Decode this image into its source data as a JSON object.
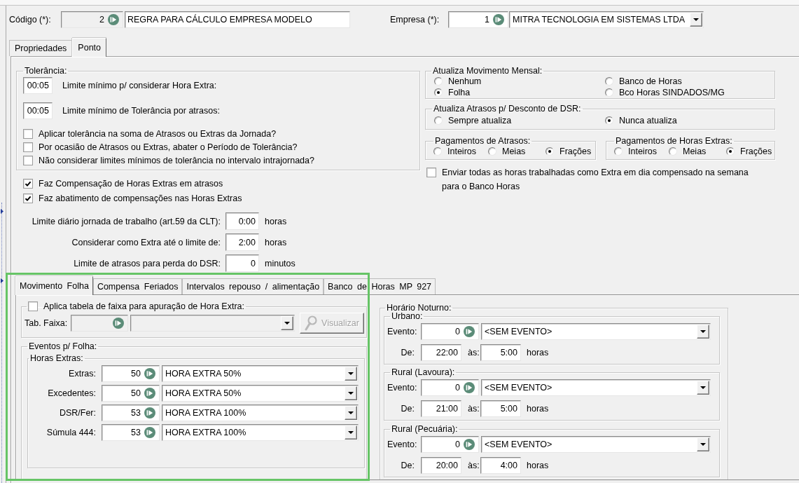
{
  "header": {
    "codigo": {
      "label": "Código (*):",
      "code": "2",
      "readonly": true,
      "kind": "text",
      "name": "REGRA PARA CÁLCULO EMPRESA MODELO"
    },
    "empresa": {
      "label": "Empresa (*):",
      "code": "1",
      "readonly": false,
      "kind": "dropdown",
      "name": "MITRA TECNOLOGIA EM SISTEMAS LTDA"
    }
  },
  "tabs": [
    {
      "label": "Propriedades",
      "selected": false
    },
    {
      "label": "Ponto",
      "selected": true
    }
  ],
  "tolerancia": {
    "title": "Tolerância:",
    "fields": [
      {
        "value": "00:05",
        "label": "Limite mínimo p/ considerar Hora Extra:"
      },
      {
        "value": "00:05",
        "label": "Limite mínimo de Tolerância por atrasos:"
      }
    ],
    "checkboxes": [
      {
        "label": "Aplicar tolerância na soma de Atrasos ou Extras da Jornada?",
        "checked": false
      },
      {
        "label": "Por ocasião de Atrasos ou Extras, abater o Período de Tolerância?",
        "checked": false
      },
      {
        "label": "Não considerar limites mínimos de tolerância no intervalo intrajornada?",
        "checked": false
      }
    ]
  },
  "compensacao": [
    {
      "label": "Faz Compensação de Horas Extras em atrasos",
      "checked": true
    },
    {
      "label": "Faz abatimento de compensações nas Horas Extras",
      "checked": true
    }
  ],
  "limites": [
    {
      "label": "Limite diário jornada de trabalho (art.59 da CLT):",
      "value": "0:00",
      "unit": "horas"
    },
    {
      "label": "Considerar como Extra até o limite de:",
      "value": "2:00",
      "unit": "horas"
    },
    {
      "label": "Limite de atrasos para perda do DSR:",
      "value": "0",
      "unit": "minutos"
    }
  ],
  "atualiza_movimento": {
    "title": "Atualiza Movimento Mensal:",
    "options": [
      {
        "label": "Nenhum",
        "selected": false
      },
      {
        "label": "Folha",
        "selected": true
      },
      {
        "label": "Banco de Horas",
        "selected": false
      },
      {
        "label": "Bco Horas SINDADOS/MG",
        "selected": false
      }
    ]
  },
  "atualiza_atrasos": {
    "title": "Atualiza Atrasos p/ Desconto de DSR:",
    "options": [
      {
        "label": "Sempre atualiza",
        "selected": false
      },
      {
        "label": "Nunca atualiza",
        "selected": true
      }
    ]
  },
  "pagamentos": [
    {
      "title": "Pagamentos de Atrasos:",
      "options": [
        {
          "label": "Inteiros",
          "selected": false
        },
        {
          "label": "Meias",
          "selected": false
        },
        {
          "label": "Frações",
          "selected": true
        }
      ]
    },
    {
      "title": "Pagamentos de Horas Extras:",
      "options": [
        {
          "label": "Inteiros",
          "selected": false
        },
        {
          "label": "Meias",
          "selected": false
        },
        {
          "label": "Frações",
          "selected": true
        }
      ]
    }
  ],
  "enviar": {
    "label": "Enviar todas as horas trabalhadas como Extra em dia compensado na semana para o Banco Horas",
    "checked": false
  },
  "sub_tabs": [
    {
      "label": "Movimento Folha",
      "selected": true
    },
    {
      "label": "Compensa Feriados",
      "selected": false
    },
    {
      "label": "Intervalos repouso / alimentação",
      "selected": false
    },
    {
      "label": "Banco de Horas MP 927",
      "selected": false
    }
  ],
  "faixa": {
    "checkbox_label": "Aplica tabela de faixa para apuração de Hora Extra:",
    "checked": false,
    "field_label": "Tab. Faixa:",
    "disabled": true,
    "button": "Visualizar"
  },
  "eventos": {
    "title": "Eventos p/ Folha:",
    "horas_extras": {
      "title": "Horas Extras:",
      "rows": [
        {
          "label": "Extras:",
          "code": "50",
          "event": "HORA EXTRA 50%"
        },
        {
          "label": "Excedentes:",
          "code": "50",
          "event": "HORA EXTRA 50%"
        },
        {
          "label": "DSR/Fer:",
          "code": "53",
          "event": "HORA EXTRA 100%"
        },
        {
          "label": "Súmula 444:",
          "code": "53",
          "event": "HORA EXTRA 100%"
        }
      ]
    }
  },
  "horario_noturno": {
    "title": "Horário Noturno:",
    "groups": [
      {
        "title": "Urbano:",
        "event_label": "Evento:",
        "code": "0",
        "event": "<SEM EVENTO>",
        "from_label": "De:",
        "from": "22:00",
        "to_label": "às:",
        "to": "5:00",
        "unit": "horas"
      },
      {
        "title": "Rural (Lavoura):",
        "event_label": "Evento:",
        "code": "0",
        "event": "<SEM EVENTO>",
        "from_label": "De:",
        "from": "21:00",
        "to_label": "às:",
        "to": "5:00",
        "unit": "horas"
      },
      {
        "title": "Rural (Pecuária):",
        "event_label": "Evento:",
        "code": "0",
        "event": "<SEM EVENTO>",
        "from_label": "De:",
        "from": "20:00",
        "to_label": "às:",
        "to": "4:00",
        "unit": "horas"
      }
    ]
  }
}
